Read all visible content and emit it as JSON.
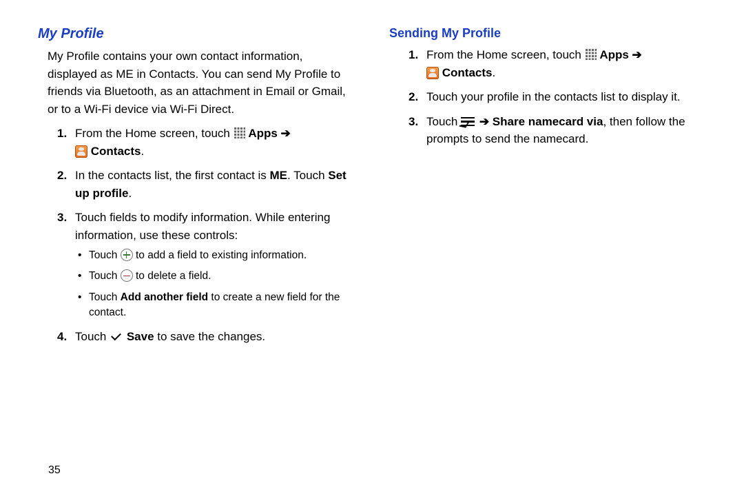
{
  "page_number": "35",
  "left": {
    "heading": "My Profile",
    "description": "My Profile contains your own contact information, displayed as ME in Contacts. You can send My Profile to friends via Bluetooth, as an attachment in Email or Gmail, or to a Wi-Fi device via Wi-Fi Direct.",
    "step1_a": "From the Home screen, touch ",
    "step1_apps": "Apps",
    "step1_arrow": " ➔ ",
    "step1_contacts": "Contacts",
    "step1_dot": ".",
    "step2_a": "In the contacts list, the first contact is ",
    "step2_me": "ME",
    "step2_b": ". Touch ",
    "step2_setup": "Set up profile",
    "step2_dot": ".",
    "step3": "Touch fields to modify information. While entering information, use these controls:",
    "sub_a_1": "Touch ",
    "sub_a_2": " to add a field to existing information.",
    "sub_b_1": "Touch ",
    "sub_b_2": " to delete a field.",
    "sub_c_1": "Touch ",
    "sub_c_bold": "Add another field",
    "sub_c_2": " to create a new field for the contact.",
    "step4_a": "Touch ",
    "step4_save": "Save",
    "step4_b": " to save the changes."
  },
  "right": {
    "heading": "Sending My Profile",
    "step1_a": "From the Home screen, touch ",
    "step1_apps": "Apps",
    "step1_arrow": " ➔ ",
    "step1_contacts": "Contacts",
    "step1_dot": ".",
    "step2": "Touch your profile in the contacts list to display it.",
    "step3_a": "Touch ",
    "step3_arrow": " ➔ ",
    "step3_share": "Share namecard via",
    "step3_b": ", then follow the prompts to send the namecard."
  }
}
